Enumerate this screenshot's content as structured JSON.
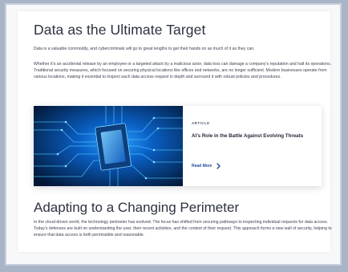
{
  "section1": {
    "title": "Data as the Ultimate Target",
    "para1": "Data is a valuable commodity, and cybercriminals will go to great lengths to get their hands on as much of it as they can.",
    "para2": "Whether it’s an accidental release by an employee or a targeted attack by a malicious actor, data loss can damage a company’s reputation and halt its operations. Traditional security measures, which focused on securing physical locations like offices and networks, are no longer sufficient. Modern businesses operate from various locations, making it essential to inspect each data access request in depth and surround it with robust policies and procedures."
  },
  "card": {
    "tag": "ARTICLE",
    "title": "AI’s Role in the Battle Against Evolving Threats",
    "link_label": "Read More",
    "link_icon": "chevron-right-icon",
    "image_icon": "circuit-board-chip-image",
    "accent": "#1d4b9c"
  },
  "section2": {
    "title": "Adapting to a Changing Perimeter",
    "para": "In the cloud-driven world, the technology perimeter has evolved. The focus has shifted from securing pathways to inspecting individual requests for data access. Today’s defenses are built on understanding the user, their recent activities, and the context of their request. This approach forms a new wall of security, helping to ensure that data access is both permissible and reasonable."
  }
}
